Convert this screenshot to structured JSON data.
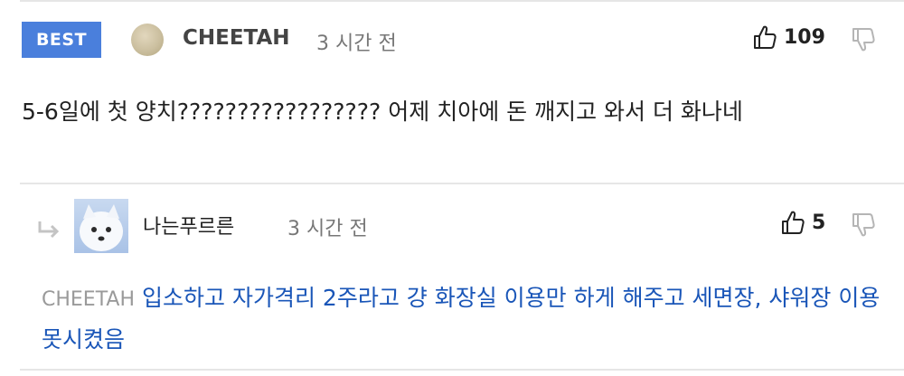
{
  "best_comment": {
    "badge": "BEST",
    "author": "CHEETAH",
    "time": "3 시간 전",
    "likes": "109",
    "text": "5-6일에 첫 양치????????????????? 어제 치아에 돈 깨지고 와서 더 화나네"
  },
  "reply": {
    "author": "나는푸르른",
    "time": "3 시간 전",
    "likes": "5",
    "mention": "CHEETAH",
    "text": "입소하고 자가격리 2주라고 걍 화장실 이용만 하게 해주고 세면장, 샤워장 이용 못시켰음"
  },
  "colors": {
    "badge": "#4a7fdc",
    "reply_text": "#1a56b8",
    "muted": "#9a9a9a"
  },
  "icons": [
    "thumbs-up-icon",
    "thumbs-down-icon",
    "reply-arrow-icon"
  ]
}
